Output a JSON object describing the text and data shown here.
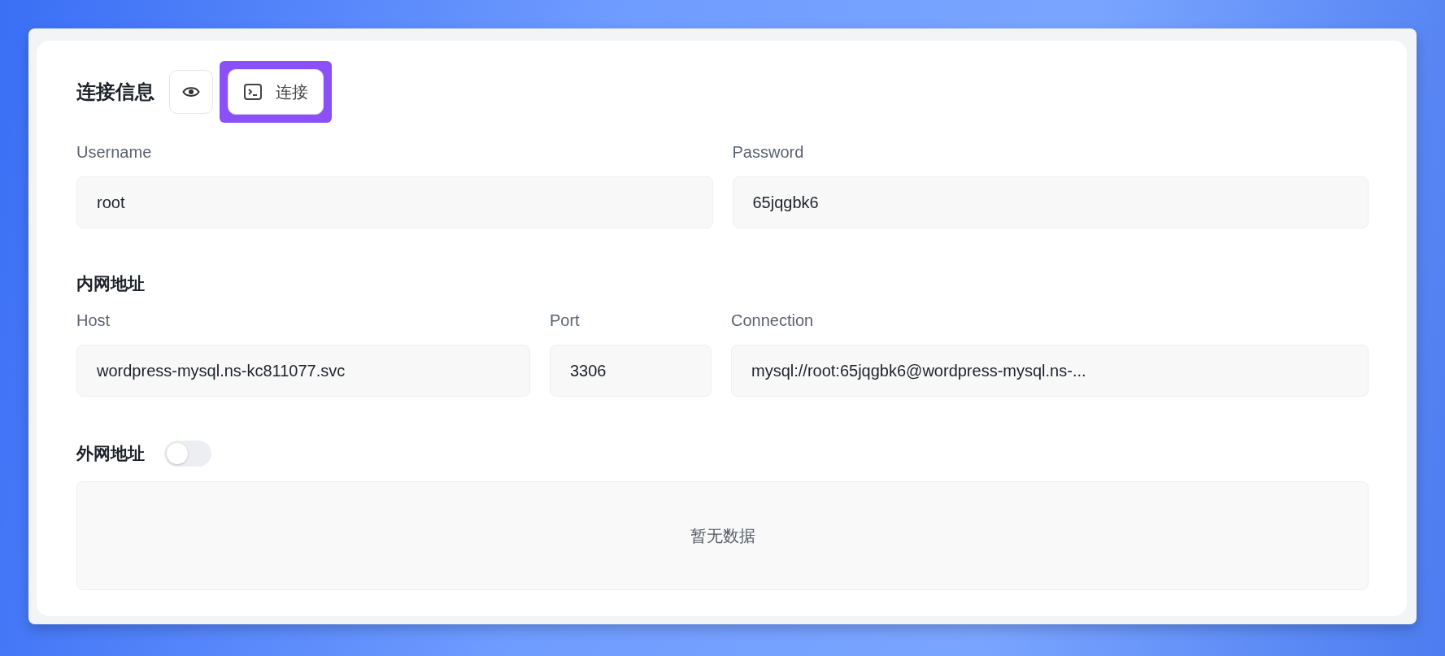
{
  "section": {
    "title": "连接信息",
    "connect_button": {
      "label": "连接",
      "highlighted": true
    }
  },
  "credentials": [
    {
      "label": "Username",
      "value": "root"
    },
    {
      "label": "Password",
      "value": "65jqgbk6"
    }
  ],
  "internal": {
    "title": "内网地址",
    "fields": [
      {
        "label": "Host",
        "value": "wordpress-mysql.ns-kc811077.svc"
      },
      {
        "label": "Port",
        "value": "3306"
      },
      {
        "label": "Connection",
        "value": "mysql://root:65jqgbk6@wordpress-mysql.ns-..."
      }
    ]
  },
  "external": {
    "title": "外网地址",
    "toggle": {
      "on": false
    },
    "empty_text": "暂无数据"
  }
}
